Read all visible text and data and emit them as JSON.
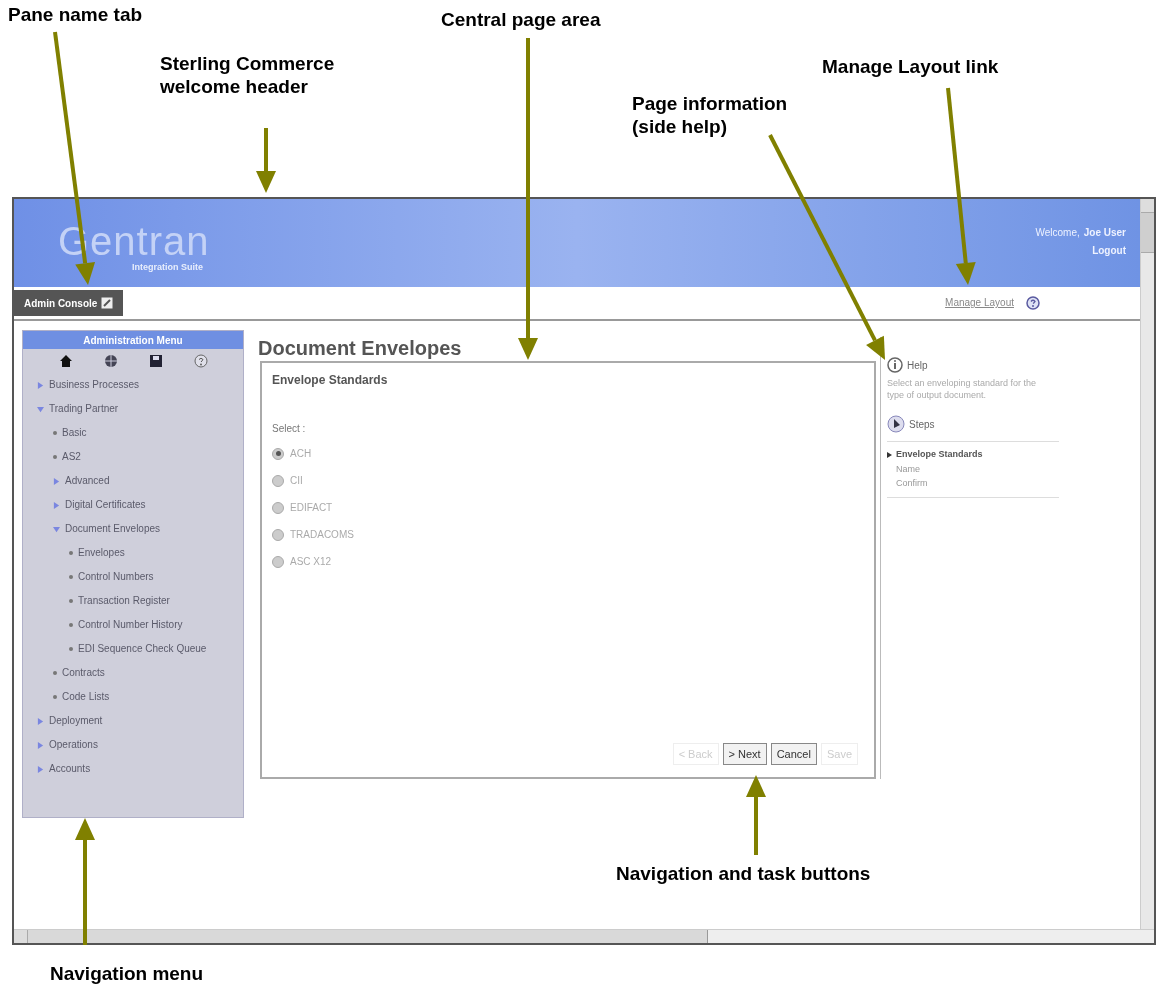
{
  "callouts": [
    {
      "text": "Pane name tab"
    },
    {
      "text": "Central page area"
    },
    {
      "text": "Sterling Commerce welcome header"
    },
    {
      "text": "Manage Layout link"
    },
    {
      "text": "Page information (side help)"
    },
    {
      "text": "Navigation and task buttons"
    },
    {
      "text": "Navigation menu"
    }
  ],
  "header": {
    "logo": "Gentran",
    "subtitle": "Integration Suite",
    "welcome": "Welcome,",
    "user": "Joe User",
    "logout": "Logout"
  },
  "tab_bar": {
    "tab": "Admin Console",
    "manage_layout": "Manage Layout"
  },
  "menu": {
    "title": "Administration Menu",
    "items": [
      {
        "label": "Business Processes",
        "expanded": false
      },
      {
        "label": "Trading Partner",
        "expanded": true,
        "children": [
          {
            "label": "Basic"
          },
          {
            "label": "AS2"
          },
          {
            "label": "Advanced",
            "expanded": false
          },
          {
            "label": "Digital Certificates",
            "expanded": false
          },
          {
            "label": "Document Envelopes",
            "expanded": true,
            "children": [
              {
                "label": "Envelopes"
              },
              {
                "label": "Control Numbers"
              },
              {
                "label": "Transaction Register"
              },
              {
                "label": "Control Number History"
              },
              {
                "label": "EDI Sequence Check Queue"
              }
            ]
          },
          {
            "label": "Contracts"
          },
          {
            "label": "Code Lists"
          }
        ]
      },
      {
        "label": "Deployment",
        "expanded": false
      },
      {
        "label": "Operations",
        "expanded": false
      },
      {
        "label": "Accounts",
        "expanded": false
      }
    ]
  },
  "page": {
    "title": "Document Envelopes",
    "panel_title": "Envelope Standards",
    "select_label": "Select :",
    "options": [
      {
        "label": "ACH",
        "selected": true
      },
      {
        "label": "CII",
        "selected": false
      },
      {
        "label": "EDIFACT",
        "selected": false
      },
      {
        "label": "TRADACOMS",
        "selected": false
      },
      {
        "label": "ASC X12",
        "selected": false
      }
    ],
    "buttons": [
      {
        "label": "< Back",
        "disabled": true
      },
      {
        "label": "> Next",
        "disabled": false
      },
      {
        "label": "Cancel",
        "disabled": false
      },
      {
        "label": "Save",
        "disabled": true
      }
    ]
  },
  "side_help": {
    "help_title": "Help",
    "help_text": "Select an enveloping standard for the type of output document.",
    "steps_title": "Steps",
    "steps": [
      {
        "label": "Envelope Standards",
        "selected": true
      },
      {
        "label": "Name",
        "selected": false
      },
      {
        "label": "Confirm",
        "selected": false
      }
    ]
  }
}
